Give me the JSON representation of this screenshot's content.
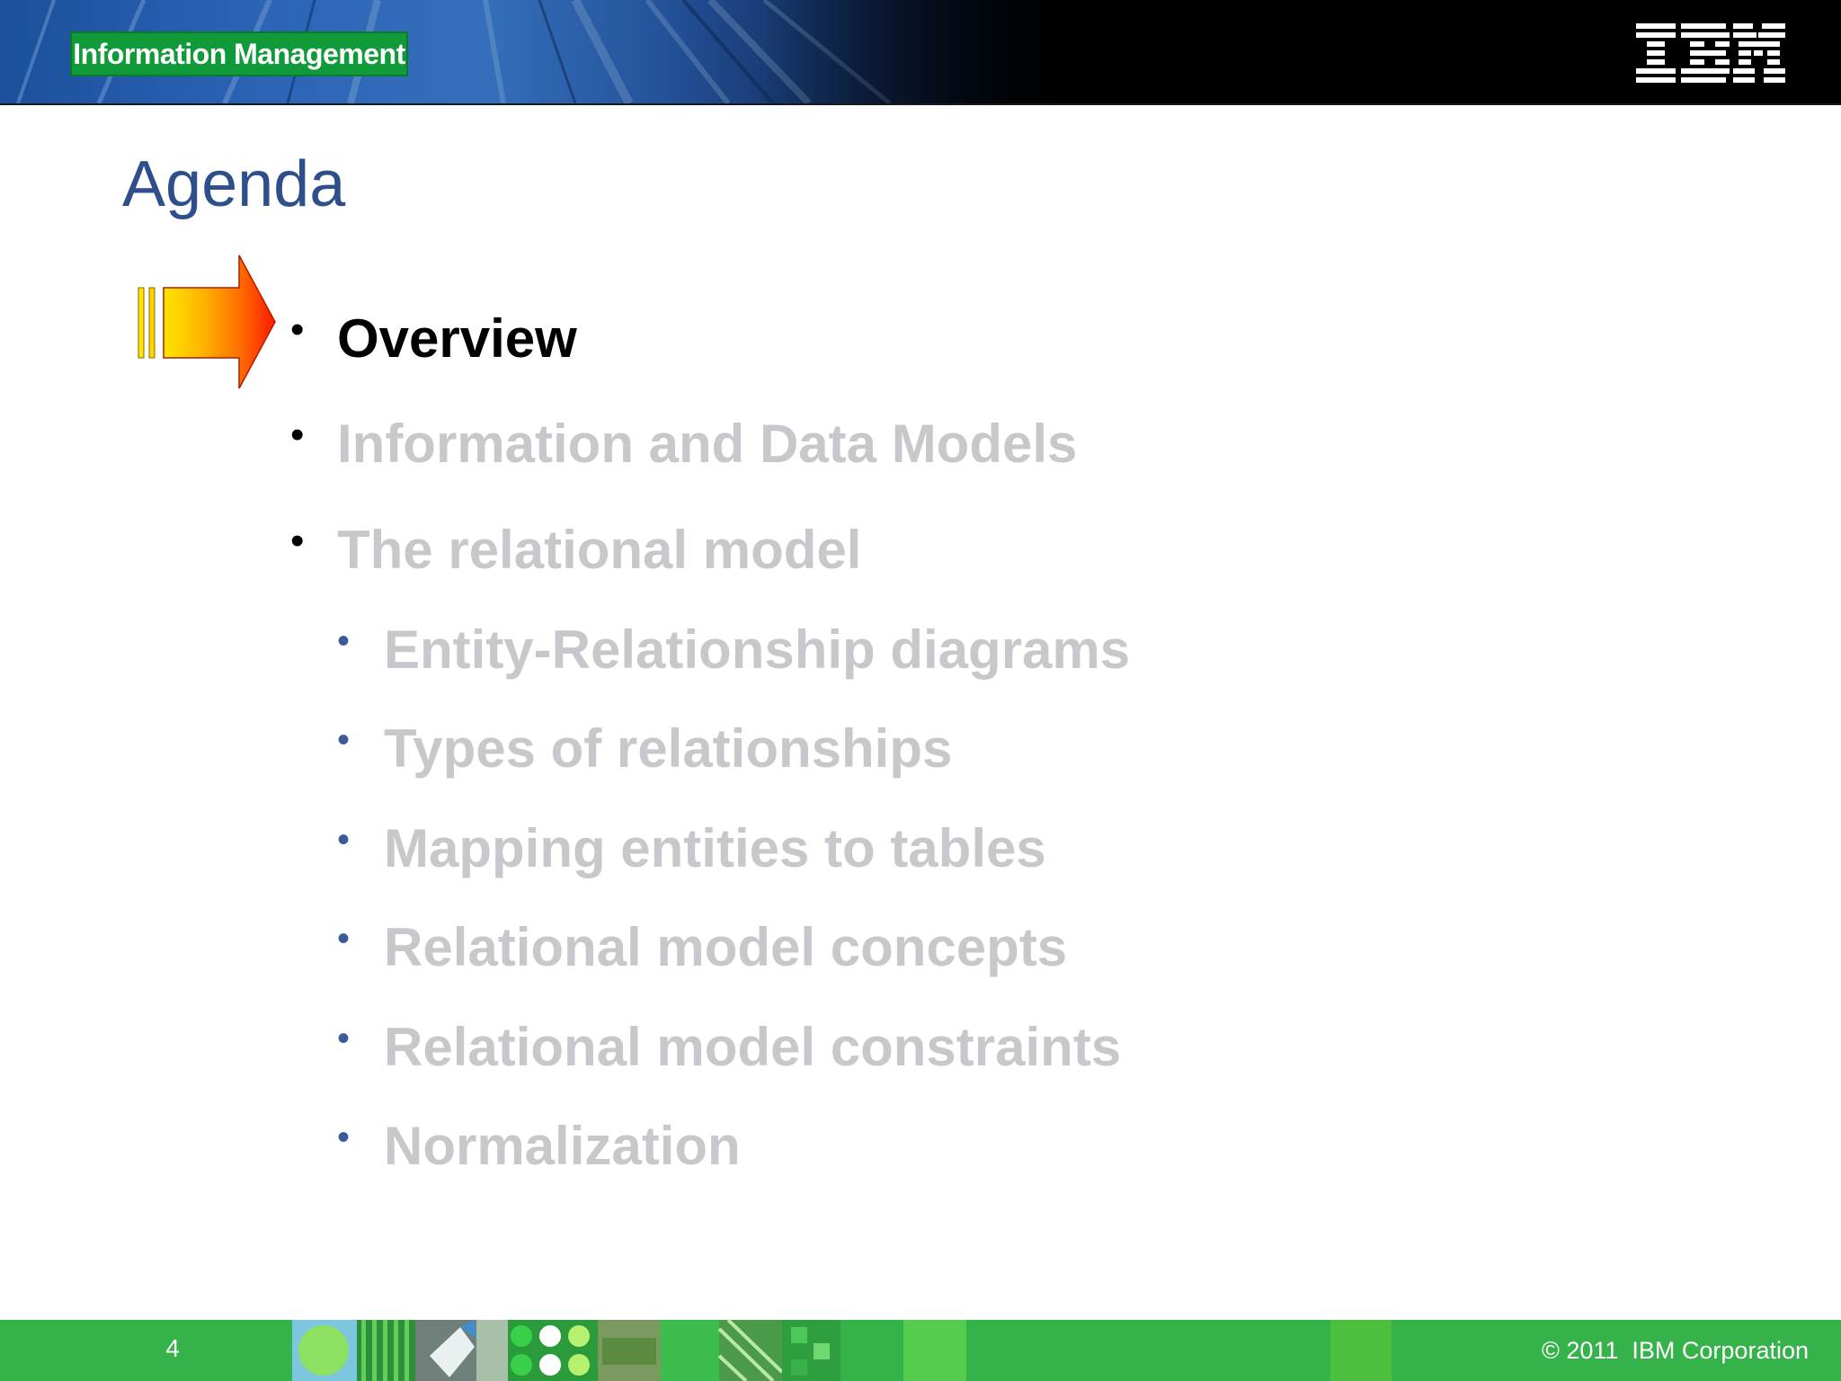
{
  "header": {
    "badge_label": "Information Management",
    "logo_name": "IBM",
    "logo_icon": "ibm-logo-icon"
  },
  "slide": {
    "title": "Agenda",
    "pointer_icon": "arrow-right-icon",
    "items": [
      {
        "label": "Overview",
        "level": 1,
        "state": "active"
      },
      {
        "label": "Information and Data Models",
        "level": 1,
        "state": "dim"
      },
      {
        "label": "The relational model",
        "level": 1,
        "state": "dim"
      },
      {
        "label": "Entity-Relationship diagrams",
        "level": 2,
        "state": "dim"
      },
      {
        "label": "Types of relationships",
        "level": 2,
        "state": "dim"
      },
      {
        "label": "Mapping entities to tables",
        "level": 2,
        "state": "dim"
      },
      {
        "label": "Relational model concepts",
        "level": 2,
        "state": "dim"
      },
      {
        "label": "Relational model constraints",
        "level": 2,
        "state": "dim"
      },
      {
        "label": "Normalization",
        "level": 2,
        "state": "dim"
      }
    ],
    "bullet_glyph": "•"
  },
  "footer": {
    "page_number": "4",
    "copyright": "© 2011  IBM Corporation"
  },
  "colors": {
    "title": "#2f4e8c",
    "active_text": "#000000",
    "dim_text": "#c8c8cc",
    "footer_green": "#36b24a",
    "badge_green": "#109a3a"
  }
}
